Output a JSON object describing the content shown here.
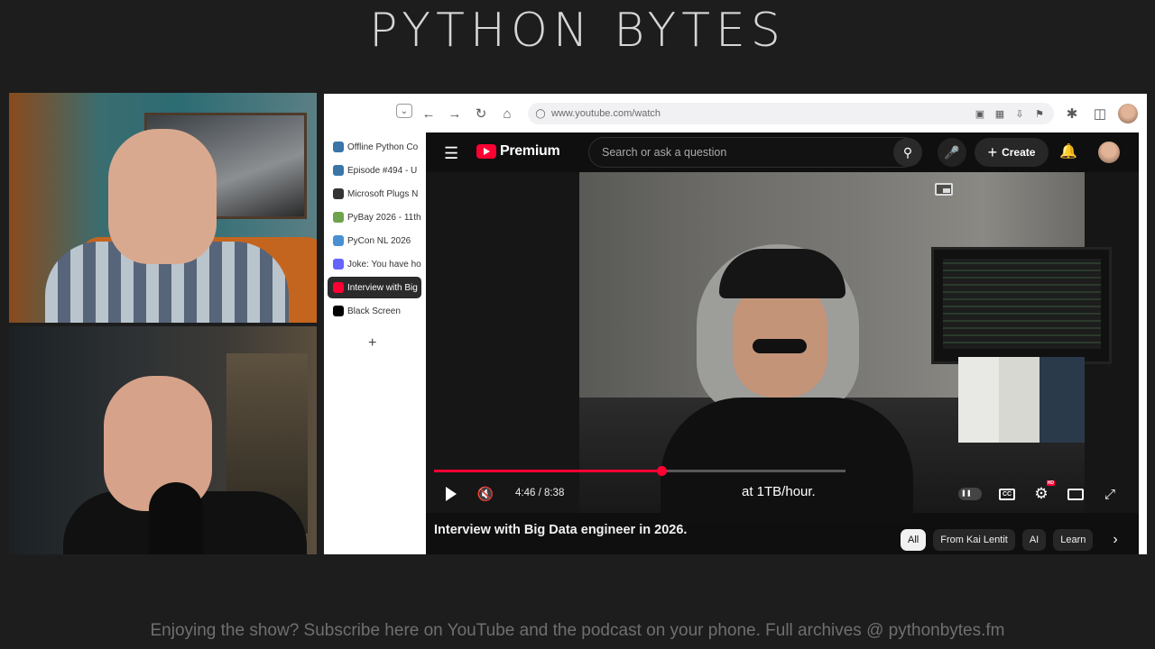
{
  "show": {
    "title": "PYTHON BYTES",
    "footer": "Enjoying the show? Subscribe here on YouTube and the podcast on your phone. Full archives @ pythonbytes.fm"
  },
  "browser": {
    "url": "www.youtube.com/watch",
    "tabs": [
      {
        "label": "Offline Python Co",
        "icon": "python-icon",
        "color": "#3a75a8"
      },
      {
        "label": "Episode #494 - U",
        "icon": "python-icon",
        "color": "#3a75a8"
      },
      {
        "label": "Microsoft Plugs N",
        "icon": "microsoft-icon",
        "color": "#333333"
      },
      {
        "label": "PyBay 2026 - 11th",
        "icon": "pybay-icon",
        "color": "#6da34d"
      },
      {
        "label": "PyCon NL 2026",
        "icon": "pycon-icon",
        "color": "#4a8fd3"
      },
      {
        "label": "Joke: You have ho",
        "icon": "mastodon-icon",
        "color": "#6364ff"
      },
      {
        "label": "Interview with Big",
        "icon": "youtube-icon",
        "color": "#ff0033"
      },
      {
        "label": "Black Screen",
        "icon": "black-square-icon",
        "color": "#000000"
      }
    ],
    "new_tab_label": "+"
  },
  "youtube": {
    "logo_text": "Premium",
    "search_placeholder": "Search or ask a question",
    "create_label": "Create",
    "create_plus": "+",
    "player": {
      "current_time": "4:46",
      "duration": "8:38",
      "time_display": "4:46 / 8:38",
      "progress_fraction": 0.552,
      "buffered_fraction": 0.7,
      "caption": "at 1TB/hour.",
      "hd_badge": "HD"
    },
    "video_title": "Interview with Big Data engineer in 2026.",
    "chips": [
      "All",
      "From Kai Lentit",
      "AI",
      "Learn"
    ],
    "accent_color": "#ff0033"
  }
}
